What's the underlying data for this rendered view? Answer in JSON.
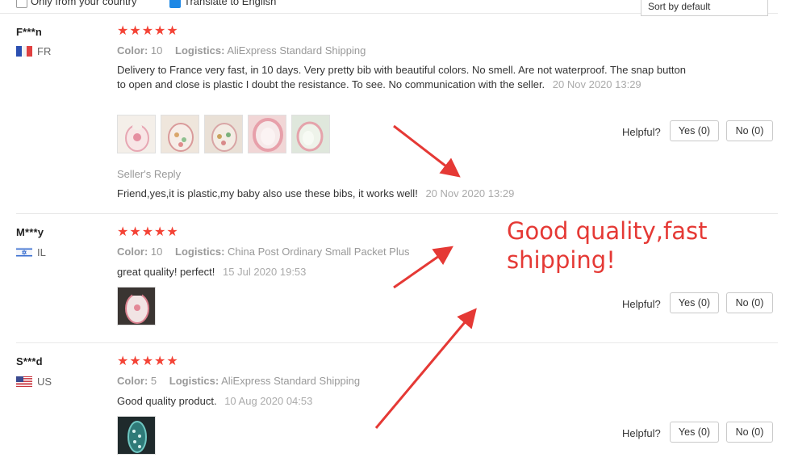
{
  "filters": {
    "only_country_label": "Only from your country",
    "translate_label": "Translate to English",
    "sort_value": "Sort by default"
  },
  "helpful_label": "Helpful?",
  "reviews": [
    {
      "author": "F***n",
      "country": "FR",
      "stars": "★★★★★",
      "color_key": "Color:",
      "color_value": "10",
      "logistics_key": "Logistics:",
      "logistics_value": "AliExpress Standard Shipping",
      "text": "Delivery to France very fast, in 10 days. Very pretty bib with beautiful colors. No smell. Are not waterproof. The snap button to open and close is plastic I doubt the resistance. To see. No communication with the seller.",
      "date": "20 Nov 2020 13:29",
      "yes": "Yes (0)",
      "no": "No (0)",
      "reply_title": "Seller's Reply",
      "reply_text": "Friend,yes,it is plastic,my baby also use these bibs, it works well!",
      "reply_date": "20 Nov 2020 13:29"
    },
    {
      "author": "M***y",
      "country": "IL",
      "stars": "★★★★★",
      "color_key": "Color:",
      "color_value": "10",
      "logistics_key": "Logistics:",
      "logistics_value": "China Post Ordinary Small Packet Plus",
      "text": "great quality! perfect!",
      "date": "15 Jul 2020 19:53",
      "yes": "Yes (0)",
      "no": "No (0)"
    },
    {
      "author": "S***d",
      "country": "US",
      "stars": "★★★★★",
      "color_key": "Color:",
      "color_value": "5",
      "logistics_key": "Logistics:",
      "logistics_value": "AliExpress Standard Shipping",
      "text": "Good quality product.",
      "date": "10 Aug 2020 04:53",
      "yes": "Yes (0)",
      "no": "No (0)"
    }
  ],
  "annotation": {
    "text": "Good quality,fast shipping!",
    "color": "#e53935"
  },
  "colors": {
    "star": "#f44336",
    "checkbox_checked": "#1e88e5"
  }
}
